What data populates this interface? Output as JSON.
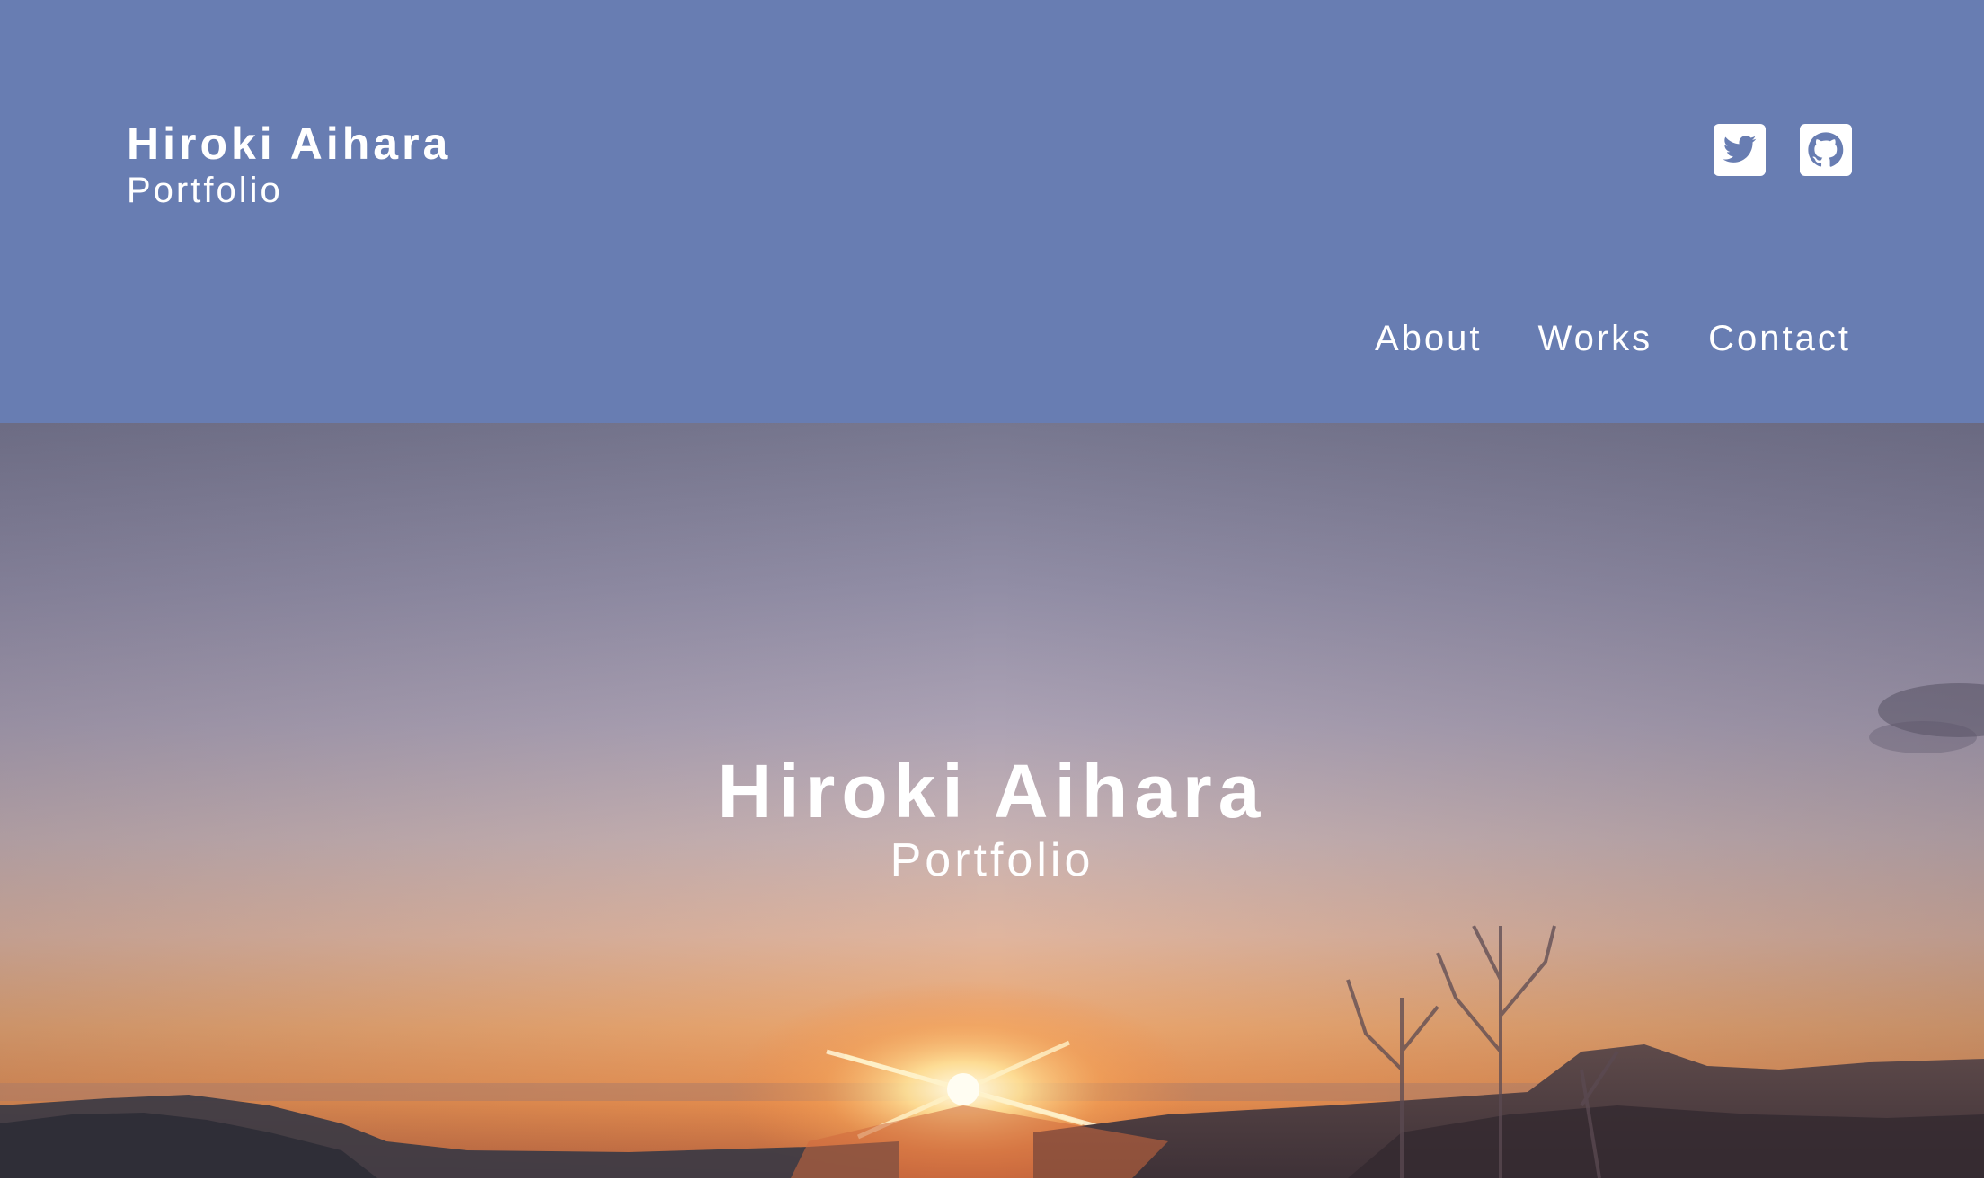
{
  "header": {
    "name": "Hiroki Aihara",
    "subtitle": "Portfolio",
    "social": [
      {
        "icon": "twitter-icon"
      },
      {
        "icon": "github-icon"
      }
    ],
    "nav": [
      {
        "label": "About"
      },
      {
        "label": "Works"
      },
      {
        "label": "Contact"
      }
    ]
  },
  "hero": {
    "name": "Hiroki Aihara",
    "subtitle": "Portfolio",
    "image": "sunrise-landscape"
  },
  "colors": {
    "header_bg": "#687db2",
    "text": "#ffffff"
  }
}
